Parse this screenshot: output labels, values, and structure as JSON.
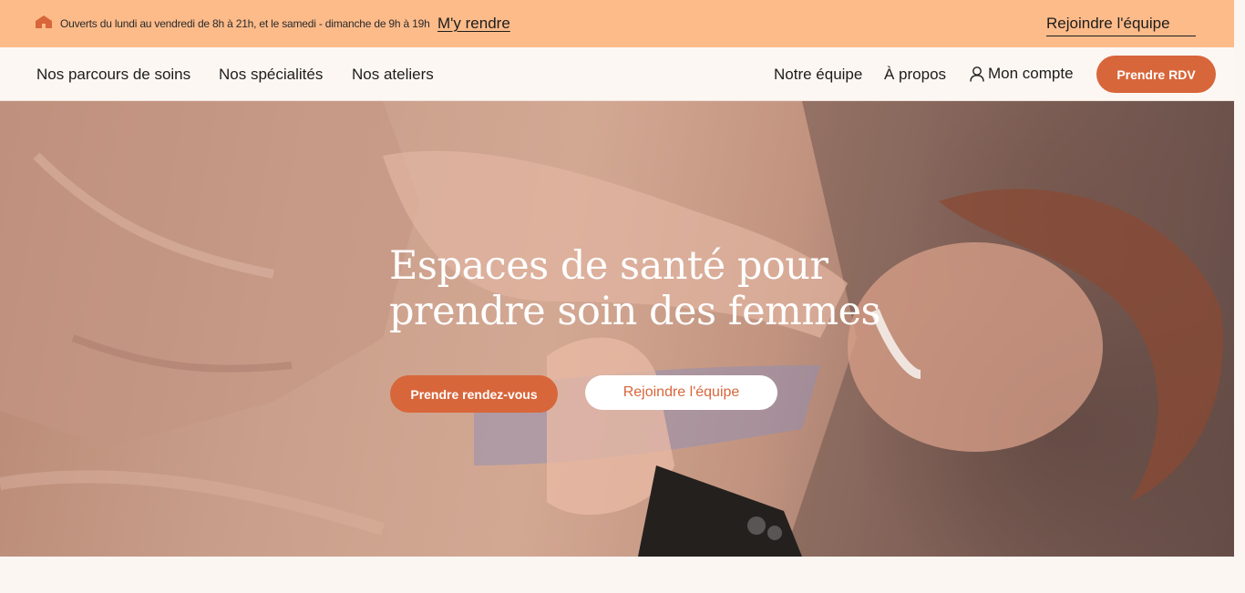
{
  "topbar": {
    "hours_text": "Ouverts du lundi au vendredi de 8h à 21h, et le samedi - dimanche de 9h à 19h",
    "directions_label": "M'y rendre",
    "join_label": "Rejoindre l'équipe",
    "icon": "home-icon"
  },
  "nav": {
    "left_items": [
      "Nos parcours de soins",
      "Nos spécialités",
      "Nos ateliers"
    ],
    "team_label": "Notre équipe",
    "about_label": "À propos",
    "account_label": "Mon compte",
    "account_icon": "user-icon",
    "cta_label": "Prendre RDV"
  },
  "hero": {
    "title_line1": "Espaces de santé pour",
    "title_line2": "prendre soin des femmes",
    "book_label": "Prendre rendez-vous",
    "join_label": "Rejoindre l'équipe"
  },
  "colors": {
    "topbar_bg": "#fdbb8a",
    "accent": "#d8663b",
    "nav_bg": "#fdf7f3",
    "page_bg": "#fbf6f2"
  }
}
